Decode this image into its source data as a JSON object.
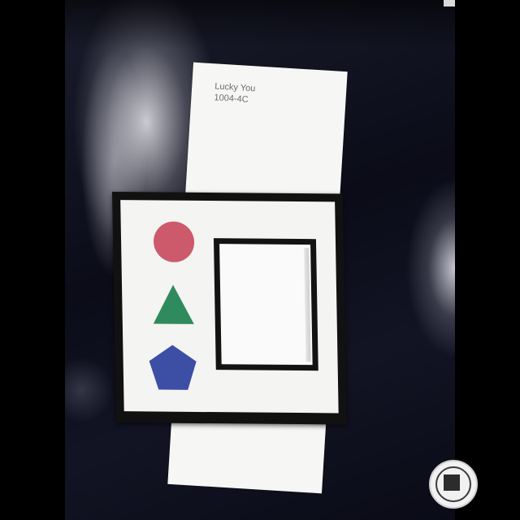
{
  "paint_card": {
    "name": "Lucky You",
    "code": "1004-4C"
  },
  "shapes": [
    {
      "name": "circle",
      "color": "#cc5a6a"
    },
    {
      "name": "triangle",
      "color": "#2f8a5e"
    },
    {
      "name": "pentagon",
      "color": "#3d4ea5"
    }
  ],
  "colors": {
    "background": "#0b0c18",
    "card": "#f6f6f4",
    "frame_border": "#131313"
  }
}
